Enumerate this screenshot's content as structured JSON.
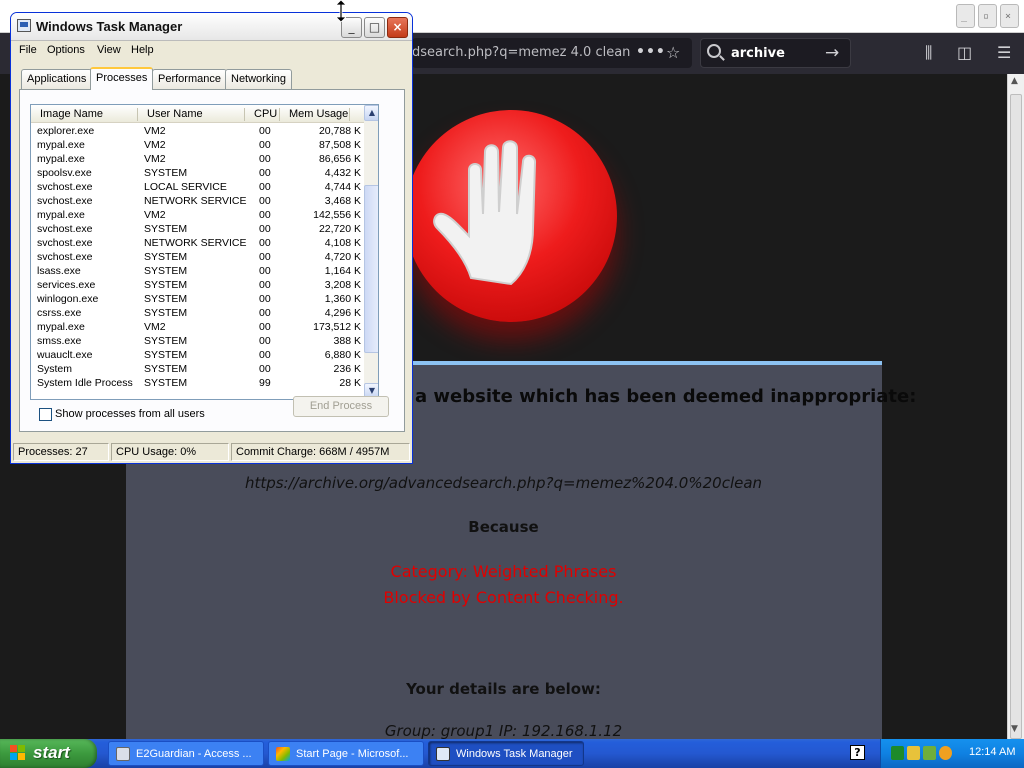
{
  "browser": {
    "url_text": "dsearch.php?q=memez 4.0 clean",
    "search_value": "archive",
    "page": {
      "message_line": "a website which has been deemed inappropriate:",
      "blocked_url": "https://archive.org/advancedsearch.php?q=memez%204.0%20clean",
      "because": "Because",
      "category": "Category: Weighted Phrases",
      "blocked_by": "Blocked by Content Checking.",
      "details_heading": "Your details are below:",
      "group_ip": "Group: group1   IP: 192.168.1.12"
    }
  },
  "task_manager": {
    "title": "Windows Task Manager",
    "menu": [
      "File",
      "Options",
      "View",
      "Help"
    ],
    "tabs": [
      "Applications",
      "Processes",
      "Performance",
      "Networking"
    ],
    "active_tab": "Processes",
    "columns": [
      "Image Name",
      "User Name",
      "CPU",
      "Mem Usage"
    ],
    "processes": [
      {
        "name": "explorer.exe",
        "user": "VM2",
        "cpu": "00",
        "mem": "20,788 K"
      },
      {
        "name": "mypal.exe",
        "user": "VM2",
        "cpu": "00",
        "mem": "87,508 K"
      },
      {
        "name": "mypal.exe",
        "user": "VM2",
        "cpu": "00",
        "mem": "86,656 K"
      },
      {
        "name": "spoolsv.exe",
        "user": "SYSTEM",
        "cpu": "00",
        "mem": "4,432 K"
      },
      {
        "name": "svchost.exe",
        "user": "LOCAL SERVICE",
        "cpu": "00",
        "mem": "4,744 K"
      },
      {
        "name": "svchost.exe",
        "user": "NETWORK SERVICE",
        "cpu": "00",
        "mem": "3,468 K"
      },
      {
        "name": "mypal.exe",
        "user": "VM2",
        "cpu": "00",
        "mem": "142,556 K"
      },
      {
        "name": "svchost.exe",
        "user": "SYSTEM",
        "cpu": "00",
        "mem": "22,720 K"
      },
      {
        "name": "svchost.exe",
        "user": "NETWORK SERVICE",
        "cpu": "00",
        "mem": "4,108 K"
      },
      {
        "name": "svchost.exe",
        "user": "SYSTEM",
        "cpu": "00",
        "mem": "4,720 K"
      },
      {
        "name": "lsass.exe",
        "user": "SYSTEM",
        "cpu": "00",
        "mem": "1,164 K"
      },
      {
        "name": "services.exe",
        "user": "SYSTEM",
        "cpu": "00",
        "mem": "3,208 K"
      },
      {
        "name": "winlogon.exe",
        "user": "SYSTEM",
        "cpu": "00",
        "mem": "1,360 K"
      },
      {
        "name": "csrss.exe",
        "user": "SYSTEM",
        "cpu": "00",
        "mem": "4,296 K"
      },
      {
        "name": "mypal.exe",
        "user": "VM2",
        "cpu": "00",
        "mem": "173,512 K"
      },
      {
        "name": "smss.exe",
        "user": "SYSTEM",
        "cpu": "00",
        "mem": "388 K"
      },
      {
        "name": "wuauclt.exe",
        "user": "SYSTEM",
        "cpu": "00",
        "mem": "6,880 K"
      },
      {
        "name": "System",
        "user": "SYSTEM",
        "cpu": "00",
        "mem": "236 K"
      },
      {
        "name": "System Idle Process",
        "user": "SYSTEM",
        "cpu": "99",
        "mem": "28 K"
      }
    ],
    "show_all_label": "Show processes from all users",
    "show_all_checked": false,
    "end_process_label": "End Process",
    "status": {
      "processes": "Processes: 27",
      "cpu": "CPU Usage: 0%",
      "commit": "Commit Charge: 668M / 4957M"
    }
  },
  "taskbar": {
    "start_label": "start",
    "tasks": [
      {
        "label": "E2Guardian - Access ...",
        "active": false
      },
      {
        "label": "Start Page - Microsof...",
        "active": false
      },
      {
        "label": "Windows Task Manager",
        "active": true
      }
    ],
    "help_label": "?",
    "clock": "12:14 AM"
  }
}
